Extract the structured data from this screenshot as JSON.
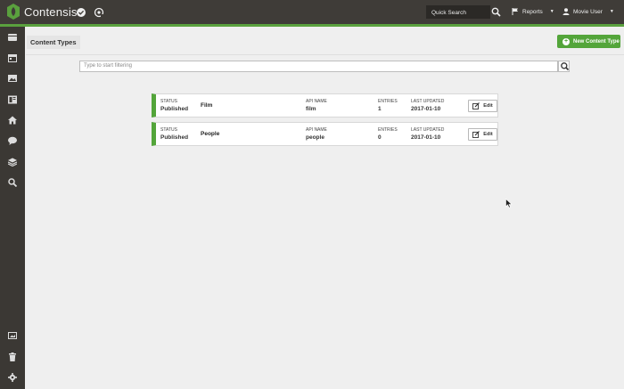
{
  "app": {
    "brand": "Contensis",
    "quick_search": "Quick Search",
    "reports_label": "Reports",
    "user_label": "Movie User",
    "accent_color": "#53a53a"
  },
  "sidebar": {
    "icons": [
      "dashboard-icon",
      "calendar-icon",
      "image-icon",
      "content-icon",
      "home-icon",
      "comment-icon",
      "layers-icon",
      "search-icon",
      "media-icon",
      "trash-icon",
      "settings-icon"
    ]
  },
  "page": {
    "title": "Content Types",
    "new_button": "New Content Type",
    "filter_placeholder": "Type to start filtering"
  },
  "content_types": [
    {
      "status_label": "STATUS",
      "status": "Published",
      "name": "Film",
      "api_label": "API NAME",
      "api_name": "film",
      "entries_label": "ENTRIES",
      "entries": "1",
      "updated_label": "LAST UPDATED",
      "updated": "2017-01-10",
      "edit_label": "Edit"
    },
    {
      "status_label": "STATUS",
      "status": "Published",
      "name": "People",
      "api_label": "API NAME",
      "api_name": "people",
      "entries_label": "ENTRIES",
      "entries": "0",
      "updated_label": "LAST UPDATED",
      "updated": "2017-01-10",
      "edit_label": "Edit"
    }
  ]
}
